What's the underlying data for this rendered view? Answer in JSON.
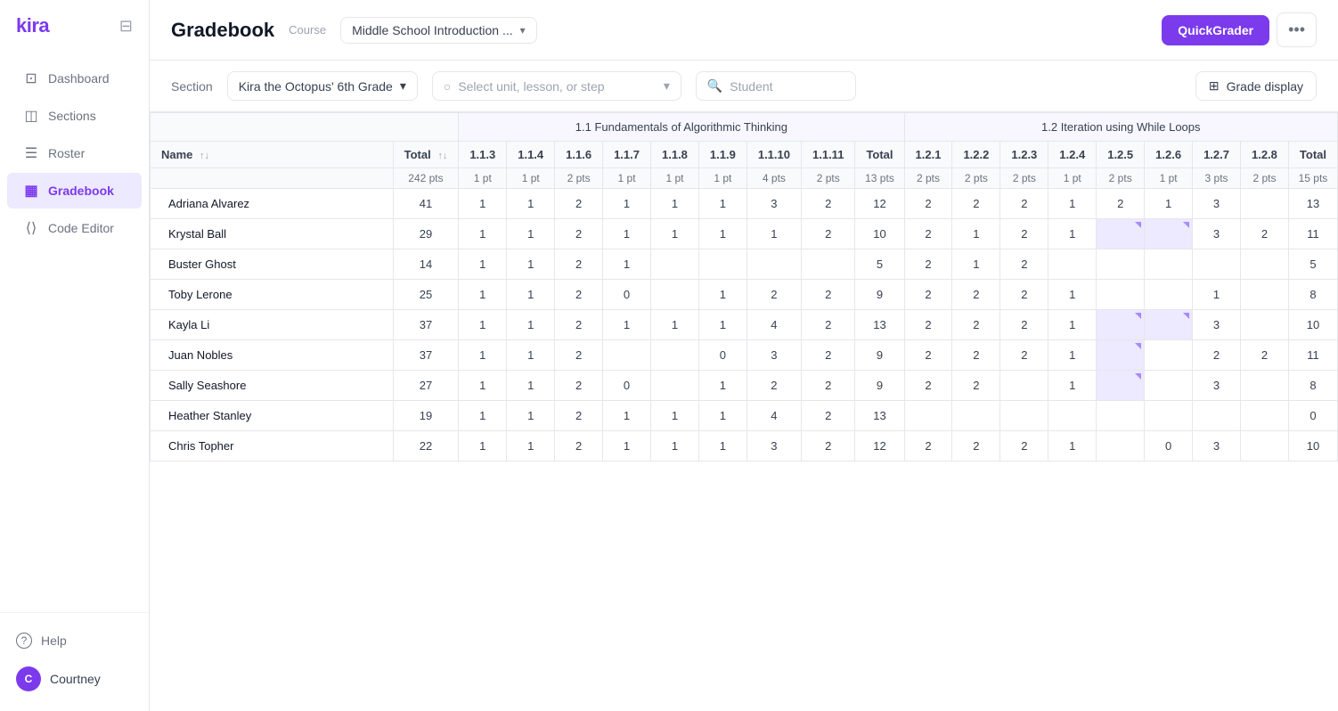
{
  "app": {
    "logo": "kira",
    "title": "Gradebook"
  },
  "sidebar": {
    "nav_items": [
      {
        "id": "dashboard",
        "label": "Dashboard",
        "icon": "⊡",
        "active": false
      },
      {
        "id": "sections",
        "label": "Sections",
        "icon": "◫",
        "active": false
      },
      {
        "id": "roster",
        "label": "Roster",
        "icon": "☰",
        "active": false
      },
      {
        "id": "gradebook",
        "label": "Gradebook",
        "icon": "▦",
        "active": true
      },
      {
        "id": "code-editor",
        "label": "Code Editor",
        "icon": "⟨⟩",
        "active": false
      }
    ],
    "help": "Help",
    "user": {
      "name": "Courtney",
      "initial": "C"
    }
  },
  "header": {
    "title": "Gradebook",
    "course_label": "Course",
    "course_name": "Middle School Introduction ...",
    "quickgrader_label": "QuickGrader",
    "more_label": "•••"
  },
  "toolbar": {
    "section_label": "Section",
    "section_value": "Kira the Octopus' 6th Grade",
    "unit_placeholder": "Select unit, lesson, or step",
    "student_placeholder": "Student",
    "grade_display_label": "Grade display"
  },
  "gradebook": {
    "group1_label": "1.1 Fundamentals of Algorithmic Thinking",
    "group2_label": "1.2 Iteration using While Loops",
    "columns": {
      "name": "Name",
      "total": "Total",
      "total_pts": "242 pts",
      "group1": {
        "cols": [
          {
            "id": "1.1.3",
            "pts": "1 pt"
          },
          {
            "id": "1.1.4",
            "pts": "1 pt"
          },
          {
            "id": "1.1.6",
            "pts": "2 pts"
          },
          {
            "id": "1.1.7",
            "pts": "1 pt"
          },
          {
            "id": "1.1.8",
            "pts": "1 pt"
          },
          {
            "id": "1.1.9",
            "pts": "1 pt"
          },
          {
            "id": "1.1.10",
            "pts": "4 pts"
          },
          {
            "id": "1.1.11",
            "pts": "2 pts"
          },
          {
            "id": "total",
            "pts": "13 pts"
          }
        ]
      },
      "group2": {
        "cols": [
          {
            "id": "1.2.1",
            "pts": "2 pts"
          },
          {
            "id": "1.2.2",
            "pts": "2 pts"
          },
          {
            "id": "1.2.3",
            "pts": "2 pts"
          },
          {
            "id": "1.2.4",
            "pts": "1 pt"
          },
          {
            "id": "1.2.5",
            "pts": "2 pts"
          },
          {
            "id": "1.2.6",
            "pts": "1 pt"
          },
          {
            "id": "1.2.7",
            "pts": "3 pts"
          },
          {
            "id": "1.2.8",
            "pts": "2 pts"
          },
          {
            "id": "total",
            "pts": "15 pts"
          }
        ]
      }
    },
    "students": [
      {
        "name": "Adriana Alvarez",
        "total": 41,
        "g1": [
          1,
          1,
          2,
          1,
          1,
          1,
          3,
          2,
          12
        ],
        "g2": [
          2,
          2,
          2,
          1,
          2,
          1,
          3,
          "",
          13
        ]
      },
      {
        "name": "Krystal Ball",
        "total": 29,
        "g1": [
          1,
          1,
          2,
          1,
          1,
          1,
          1,
          2,
          10
        ],
        "g2": [
          2,
          1,
          2,
          1,
          "",
          "",
          3,
          2,
          11
        ]
      },
      {
        "name": "Buster Ghost",
        "total": 14,
        "g1": [
          1,
          1,
          2,
          1,
          "",
          "",
          "",
          "",
          5
        ],
        "g2": [
          2,
          1,
          2,
          "",
          "",
          "",
          "",
          "",
          5
        ]
      },
      {
        "name": "Toby Lerone",
        "total": 25,
        "g1": [
          1,
          1,
          2,
          0,
          "",
          1,
          2,
          2,
          9
        ],
        "g2": [
          2,
          2,
          2,
          1,
          "",
          "",
          1,
          "",
          8
        ]
      },
      {
        "name": "Kayla Li",
        "total": 37,
        "g1": [
          1,
          1,
          2,
          1,
          1,
          1,
          4,
          2,
          13
        ],
        "g2": [
          2,
          2,
          2,
          1,
          "",
          "",
          3,
          "",
          10
        ]
      },
      {
        "name": "Juan Nobles",
        "total": 37,
        "g1": [
          1,
          1,
          2,
          "",
          "",
          0,
          3,
          2,
          9
        ],
        "g2": [
          2,
          2,
          2,
          1,
          "",
          "",
          2,
          2,
          11
        ]
      },
      {
        "name": "Sally Seashore",
        "total": 27,
        "g1": [
          1,
          1,
          2,
          0,
          "",
          1,
          2,
          2,
          9
        ],
        "g2": [
          2,
          2,
          "",
          1,
          "",
          "",
          3,
          "",
          8
        ]
      },
      {
        "name": "Heather Stanley",
        "total": 19,
        "g1": [
          1,
          1,
          2,
          1,
          1,
          1,
          4,
          2,
          13
        ],
        "g2": [
          "",
          "",
          "",
          "",
          "",
          "",
          "",
          "",
          0
        ]
      },
      {
        "name": "Chris Topher",
        "total": 22,
        "g1": [
          1,
          1,
          2,
          1,
          1,
          1,
          3,
          2,
          12
        ],
        "g2": [
          2,
          2,
          2,
          1,
          "",
          0,
          3,
          "",
          10
        ]
      }
    ]
  }
}
